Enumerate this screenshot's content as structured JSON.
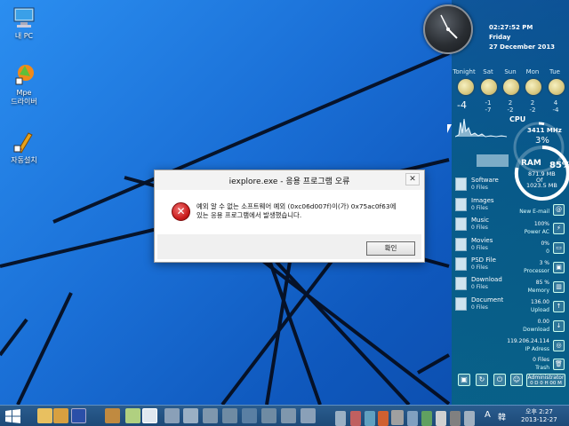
{
  "desktop": {
    "icons": [
      {
        "name": "this-pc",
        "label": "내 PC"
      },
      {
        "name": "mpe",
        "label": "Mpe\n드라이버"
      },
      {
        "name": "auto-install",
        "label": "자동설치"
      }
    ]
  },
  "sidebar": {
    "clock": {
      "time": "02:27:52 PM",
      "day": "Friday",
      "date": "27 December 2013"
    },
    "weather": {
      "days": [
        "Tonight",
        "Sat",
        "Sun",
        "Mon",
        "Tue"
      ],
      "current": "-4",
      "highs": [
        "",
        "-1",
        "2",
        "2",
        "4"
      ],
      "lows": [
        "",
        "-7",
        "-2",
        "-2",
        "-4"
      ]
    },
    "cpu": {
      "title": "CPU",
      "mhz": "3411 MHz",
      "percent": "3%"
    },
    "ram": {
      "title": "RAM",
      "used": "871.9 MB",
      "of": "Of",
      "total": "1023.5 MB",
      "percent": "85%"
    },
    "folders": [
      {
        "name": "Software",
        "count": "0 Files"
      },
      {
        "name": "Images",
        "count": "0 Files"
      },
      {
        "name": "Music",
        "count": "0 Files"
      },
      {
        "name": "Movies",
        "count": "0 Files"
      },
      {
        "name": "PSD File",
        "count": "0 Files"
      },
      {
        "name": "Download",
        "count": "0 Files"
      },
      {
        "name": "Document",
        "count": "0 Files"
      }
    ],
    "stats": [
      {
        "value": "",
        "label": "New E-mail",
        "icon": "@"
      },
      {
        "value": "100%",
        "label": "Power AC",
        "icon": "⚡"
      },
      {
        "value": "0%",
        "label": "0",
        "icon": "▭"
      },
      {
        "value": "3 %",
        "label": "Processor",
        "icon": "▣"
      },
      {
        "value": "85 %",
        "label": "Memory",
        "icon": "▥"
      },
      {
        "value": "136.00",
        "label": "Upload",
        "icon": "↑"
      },
      {
        "value": "0.00",
        "label": "Download",
        "icon": "↓"
      },
      {
        "value": "119.206.24.114",
        "label": "IP Adress",
        "icon": "◎"
      },
      {
        "value": "0 Files",
        "label": "Trash",
        "icon": "🗑"
      }
    ],
    "admin": {
      "user": "Administrator",
      "uptime": "0 D 0 H 00 M"
    }
  },
  "dialog": {
    "title": "iexplore.exe - 응용 프로그램 오류",
    "message_line1": "예외 알 수 없는 소프트웨어 예외 (0xc06d007f)이(가) 0x75ac0f63에",
    "message_line2": "있는 응용 프로그램에서 발생했습니다.",
    "ok_label": "확인",
    "close_label": "✕"
  },
  "taskbar": {
    "lang": "A",
    "tray_extra": "韓",
    "clock_line1": "오후 2:27",
    "clock_line2": "2013-12-27"
  },
  "colors": {
    "desktop": "#1a6fd6",
    "sidebar": "#0a6a86",
    "taskbar": "#1d4a78",
    "error": "#c81a1a"
  }
}
